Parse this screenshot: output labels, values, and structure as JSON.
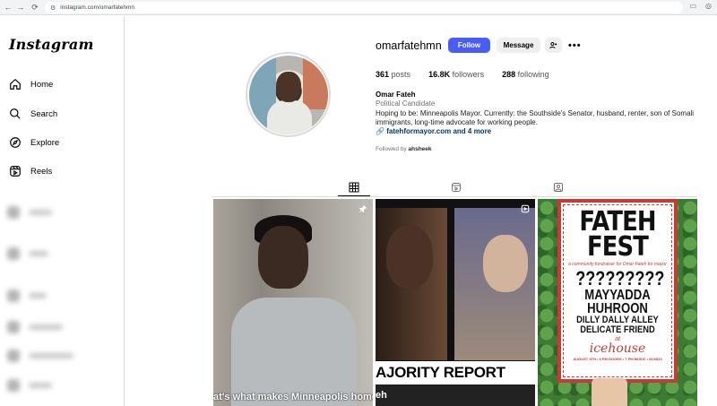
{
  "browser": {
    "url": "instagram.com/omarfatehmn",
    "back_icon": "←",
    "forward_icon": "→",
    "reload_icon": "⟳",
    "site_icon": "⚙",
    "extra_icon_1": "▭",
    "extra_icon_2": "◎"
  },
  "sidebar": {
    "logo": "Instagram",
    "items": [
      {
        "label": "Home",
        "icon": "home-icon"
      },
      {
        "label": "Search",
        "icon": "search-icon"
      },
      {
        "label": "Explore",
        "icon": "compass-icon"
      },
      {
        "label": "Reels",
        "icon": "reels-icon"
      }
    ]
  },
  "profile": {
    "username": "omarfatehmn",
    "follow_label": "Follow",
    "message_label": "Message",
    "more_label": "•••",
    "stats": {
      "posts_count": "361",
      "posts_label": "posts",
      "followers_count": "16.8K",
      "followers_label": "followers",
      "following_count": "288",
      "following_label": "following"
    },
    "full_name": "Omar Fateh",
    "category": "Political Candidate",
    "bio": "Hoping to be: Minneapolis Mayor. Currently: the Southside's Senator, husband, renter, son of Somali immigrants, long-time advocate for working people.",
    "link": "fatehformayor.com and 4 more",
    "followed_by_prefix": "Followed by",
    "followed_by_user": "ahsheek"
  },
  "tabs": [
    {
      "name": "posts",
      "icon": "grid-icon",
      "active": true
    },
    {
      "name": "reels",
      "icon": "reels-icon",
      "active": false
    },
    {
      "name": "tagged",
      "icon": "tagged-icon",
      "active": false
    }
  ],
  "posts": {
    "post1_caption": "at's what makes Minneapolis home",
    "post2_banner": "AJORITY REPORT",
    "post2_bottom": "eh",
    "poster": {
      "title": "FATEH FEST",
      "subtitle": "a community fundraiser for Omar Fateh for mayor",
      "question": "?????????",
      "line1": "MAYYADDA",
      "line2": "HUHROON",
      "line3": "DILLY DALLY ALLEY",
      "line4": "DELICATE FRIEND",
      "at": "at",
      "venue": "icehouse",
      "date": "AUGUST 9TH • 8 PM DOORS • 7 PM MUSIC • $10/$20"
    }
  },
  "colors": {
    "follow_button": "#4a5cf6",
    "link": "#00376b",
    "poster_red": "#c73a35"
  }
}
